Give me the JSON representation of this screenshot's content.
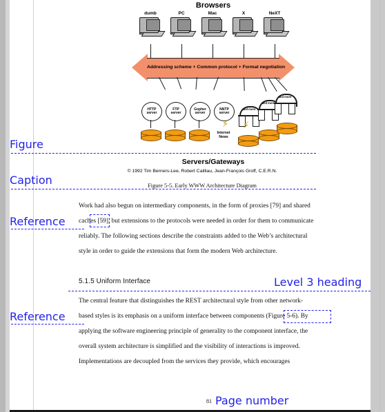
{
  "document": {
    "page_number": "81",
    "figure": {
      "title": "Browsers",
      "browsers": [
        "dumb",
        "PC",
        "Mac",
        "X",
        "NeXT"
      ],
      "arrow_label": "Addressing scheme  +  Common protocol  +  Format negotiation",
      "servers": [
        "HTTP server",
        "FTP server",
        "Gopher server",
        "NNTP server"
      ],
      "server_lines": [
        [
          "HTTP",
          "server"
        ],
        [
          "FTP",
          "server"
        ],
        [
          "Gopher",
          "server"
        ],
        [
          "NNTP",
          "server"
        ]
      ],
      "news_label": "Internet News",
      "news_lines": [
        "Internet",
        "News"
      ],
      "gateways": [
        "and more",
        "and more",
        "and more"
      ],
      "bottom_label": "Servers/Gateways",
      "copyright": "© 1992  Tim Berners-Lee, Robert Cailliau, Jean-François Groff, C.E.R.N.",
      "caption": "Figure 5-5. Early WWW Architecture Diagram"
    },
    "paragraphs": {
      "p1_a": "Work had also begun on intermediary components, in the form of proxies [79] and shared",
      "p1_b_pre": "caches",
      "p1_b_ref": "[59],",
      "p1_b_post": "but extensions to the protocols were needed in order for them to communicate",
      "p1_c": "reliably. The following sections describe the constraints added to the Web’s architectural",
      "p1_d": "style in order to guide the extensions that form the modern Web architecture.",
      "heading": "5.1.5 Uniform Interface",
      "p2_a": "The central feature that distinguishes the REST architectural style from other network-",
      "p2_b_pre": "based styles is its emphasis on a uniform interface between components",
      "p2_b_ref": "(Figure 5-6).",
      "p2_b_post": "By",
      "p2_c": "applying the software engineering principle of generality to the component interface, the",
      "p2_d": "overall system architecture is simplified and the visibility of interactions is improved.",
      "p2_e": "Implementations are decoupled from the services they provide, which encourages"
    }
  },
  "annotations": {
    "figure": "Figure",
    "caption": "Caption",
    "reference_1": "Reference",
    "reference_2": "Reference",
    "level3_heading": "Level 3 heading",
    "page_number": "Page number",
    "color": "#2222E8"
  }
}
